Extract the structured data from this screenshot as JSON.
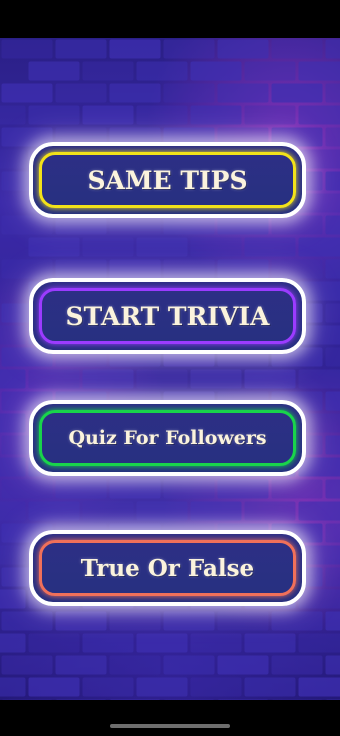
{
  "menu": {
    "buttons": [
      {
        "label": "SAME TIPS",
        "outline_color": "#f2e21a"
      },
      {
        "label": "START TRIVIA",
        "outline_color": "#9b3bff"
      },
      {
        "label": "Quiz For Followers",
        "outline_color": "#19d44b"
      },
      {
        "label": "True Or False",
        "outline_color": "#f0705a"
      }
    ]
  },
  "theme": {
    "background": "neon brick wall",
    "brick_color": "#3d2fb0",
    "glow_color": "#ffffff"
  }
}
